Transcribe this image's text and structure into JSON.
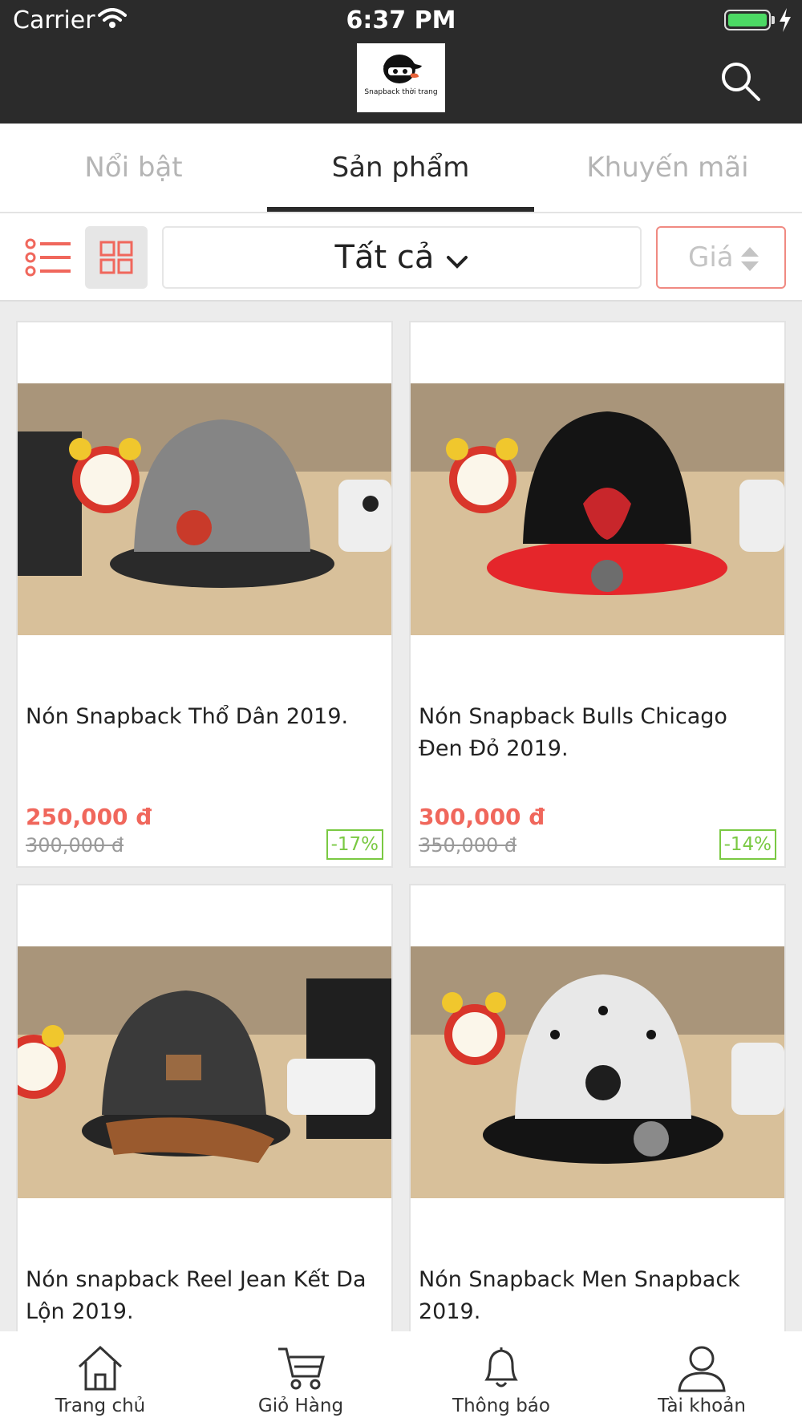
{
  "status_bar": {
    "carrier": "Carrier",
    "time": "6:37 PM"
  },
  "header": {
    "logo_text": "Snapback thời trang",
    "search_icon": "search-icon"
  },
  "tabs": [
    {
      "label": "Nổi bật",
      "active": false
    },
    {
      "label": "Sản phẩm",
      "active": true
    },
    {
      "label": "Khuyến mãi",
      "active": false
    }
  ],
  "toolbar": {
    "list_icon": "list-view-icon",
    "grid_icon": "grid-view-icon",
    "category": "Tất cả",
    "sort_label": "Giá",
    "accent_color": "#f0675c"
  },
  "products": [
    {
      "name": "Nón Snapback Thổ Dân 2019.",
      "price": "250,000 đ",
      "old_price": "300,000 đ",
      "discount": "-17%"
    },
    {
      "name": "Nón Snapback Bulls Chicago Đen Đỏ 2019.",
      "price": "300,000 đ",
      "old_price": "350,000 đ",
      "discount": "-14%"
    },
    {
      "name": "Nón snapback Reel Jean Kết Da Lộn 2019."
    },
    {
      "name": "Nón Snapback Men Snapback 2019."
    }
  ],
  "bottom_nav": [
    {
      "label": "Trang chủ",
      "icon": "home-icon"
    },
    {
      "label": "Giỏ Hàng",
      "icon": "cart-icon"
    },
    {
      "label": "Thông báo",
      "icon": "bell-icon"
    },
    {
      "label": "Tài khoản",
      "icon": "user-icon"
    }
  ]
}
